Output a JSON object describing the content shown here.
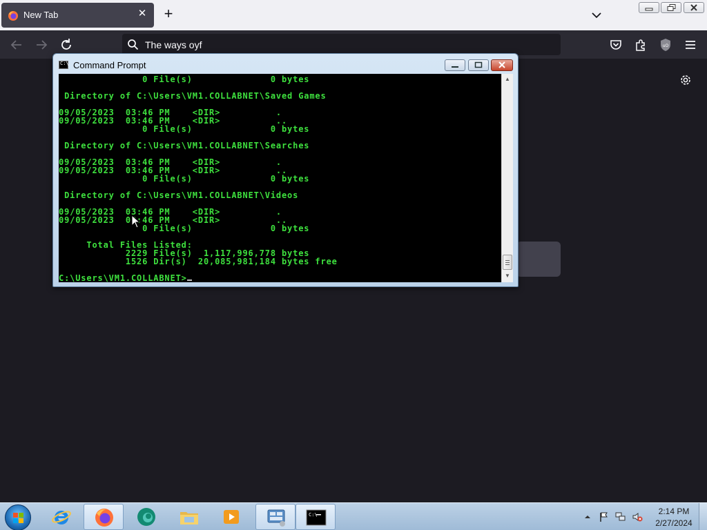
{
  "browser": {
    "tab": {
      "title": "New Tab"
    },
    "urlbar": {
      "value": "The ways oyf"
    }
  },
  "cmd": {
    "title": "Command Prompt",
    "lines": [
      "               0 File(s)              0 bytes",
      "",
      " Directory of C:\\Users\\VM1.COLLABNET\\Saved Games",
      "",
      "09/05/2023  03:46 PM    <DIR>          .",
      "09/05/2023  03:46 PM    <DIR>          ..",
      "               0 File(s)              0 bytes",
      "",
      " Directory of C:\\Users\\VM1.COLLABNET\\Searches",
      "",
      "09/05/2023  03:46 PM    <DIR>          .",
      "09/05/2023  03:46 PM    <DIR>          ..",
      "               0 File(s)              0 bytes",
      "",
      " Directory of C:\\Users\\VM1.COLLABNET\\Videos",
      "",
      "09/05/2023  03:46 PM    <DIR>          .",
      "09/05/2023  03:46 PM    <DIR>          ..",
      "               0 File(s)              0 bytes",
      "",
      "     Total Files Listed:",
      "            2229 File(s)  1,117,996,778 bytes",
      "            1526 Dir(s)  20,085,981,184 bytes free",
      "",
      "C:\\Users\\VM1.COLLABNET>"
    ]
  },
  "taskbar": {
    "items": [
      {
        "icon": "internet-explorer-icon"
      },
      {
        "icon": "firefox-icon",
        "active": true
      },
      {
        "icon": "edge-icon"
      },
      {
        "icon": "file-explorer-icon"
      },
      {
        "icon": "media-player-icon"
      },
      {
        "icon": "control-panel-icon",
        "active": true
      },
      {
        "icon": "command-prompt-icon",
        "active": true
      }
    ],
    "clock": {
      "time": "2:14 PM",
      "date": "2/27/2024"
    }
  }
}
